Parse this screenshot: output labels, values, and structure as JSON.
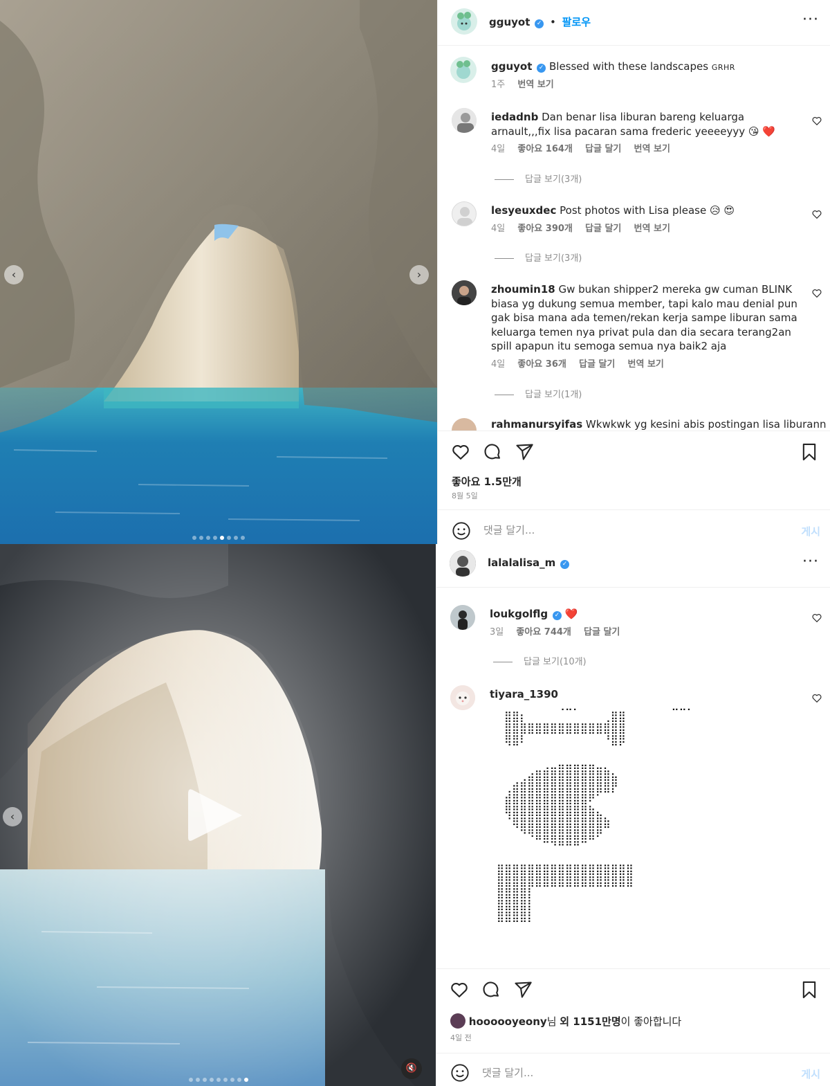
{
  "post1": {
    "author": {
      "username": "gguyot",
      "follow_label": "팔로우"
    },
    "caption": {
      "username": "gguyot",
      "text": "Blessed with these landscapes",
      "tag": "GRHR",
      "time": "1주",
      "translate": "번역 보기"
    },
    "comments": [
      {
        "username": "iedadnb",
        "text": "Dan benar lisa liburan bareng keluarga arnault,,,fix lisa pacaran sama frederic yeeeeyyy 😘 ❤️",
        "time": "4일",
        "likes": "좋아요 164개",
        "reply": "답글 달기",
        "translate": "번역 보기",
        "view_replies": "답글 보기(3개)"
      },
      {
        "username": "lesyeuxdec",
        "text": "Post photos with Lisa please 😥 😍",
        "time": "4일",
        "likes": "좋아요 390개",
        "reply": "답글 달기",
        "translate": "번역 보기",
        "view_replies": "답글 보기(3개)"
      },
      {
        "username": "zhoumin18",
        "text": "Gw bukan shipper2 mereka gw cuman BLINK biasa yg dukung semua member, tapi kalo mau denial pun gak bisa mana ada temen/rekan kerja sampe liburan sama keluarga temen nya privat pula dan dia secara terang2an spill apapun itu semoga semua nya baik2 aja",
        "time": "4일",
        "likes": "좋아요 36개",
        "reply": "답글 달기",
        "translate": "번역 보기",
        "view_replies": "답글 보기(1개)"
      },
      {
        "username": "rahmanursyifas",
        "text": "Wkwkwk yg kesini abis postingan lisa liburann"
      }
    ],
    "likes": "좋아요 1.5만개",
    "date": "8월 5일",
    "comment_placeholder": "댓글 달기...",
    "post_label": "게시"
  },
  "post2": {
    "author": {
      "username": "lalalalisa_m"
    },
    "comments": [
      {
        "username": "loukgolflg",
        "emoji": "❤️",
        "time": "3일",
        "likes": "좋아요 744개",
        "reply": "답글 달기",
        "view_replies": "답글 보기(10개)"
      },
      {
        "username": "tiyara_1390",
        "art": "⠀⠀⠀⠀⠀⠀⠀⠀⢀⣀⡀⠀⠀⠀⠀⠀⠀⠀⠀⠀⠀⠀⠀⣀⣀⡀\n⠀⣿⣿⡆⠀⠀⠀⠀⠀⠀⠀⠀⠀⠀⢀⣿⣿\n⠀⣿⣿⣿⣿⣿⣿⣿⣿⣿⣿⣿⣿⣿⣿⣿⣿\n⠀⢿⣿⠇⠀⠀⠀⠀⠀⠀⠀⠀⠀⠀⠘⣿⡿\n\n⠀⠀⠀⠀⠀⠀⢀⣀⣤⣤⣤⣤⣤⣀⡀\n⠀⠀⠀⢀⣴⣿⣿⣿⣿⣿⣿⣿⣿⣿⣿⣦\n⠀⢀⣾⣿⣿⣿⣿⣿⣿⣿⣿⣿⣿⣿⣿⡟\n⠀⣾⣿⣿⣿⣿⣿⣿⣿⣿⣿⣿⠟⠁\n⠀⢿⣿⣿⣿⣿⣿⣿⣿⣿⣿⣿⣷⣄\n⠀⠈⢿⣿⣿⣿⣿⣿⣿⣿⣿⣿⣿⣿⣷\n⠀⠀⠀⠙⠻⣿⣿⣿⣿⣿⣿⣿⣿⠟\n⠀⠀⠀⠀⠀⠀⠉⠙⠛⠛⠛⠉\n\n⣿⣿⣿⣿⣿⣿⣿⣿⣿⣿⣿⣿⣿⣿⣿⣿⣿⣿\n⣿⣿⣿⣿⣿⣿⣿⣿⣿⣿⣿⣿⣿⣿⣿⣿⣿⣿\n⣿⣿⣿⣿⡇\n⣿⣿⣿⣿⡇\n⣿⣿⣿⣿⡇"
      }
    ],
    "liked_by": {
      "user": "hoooooyeony",
      "suffix": "님 ",
      "count_text": "외 1151만명",
      "tail": "이 좋아합니다"
    },
    "date": "4일 전",
    "comment_placeholder": "댓글 달기...",
    "post_label": "게시"
  }
}
